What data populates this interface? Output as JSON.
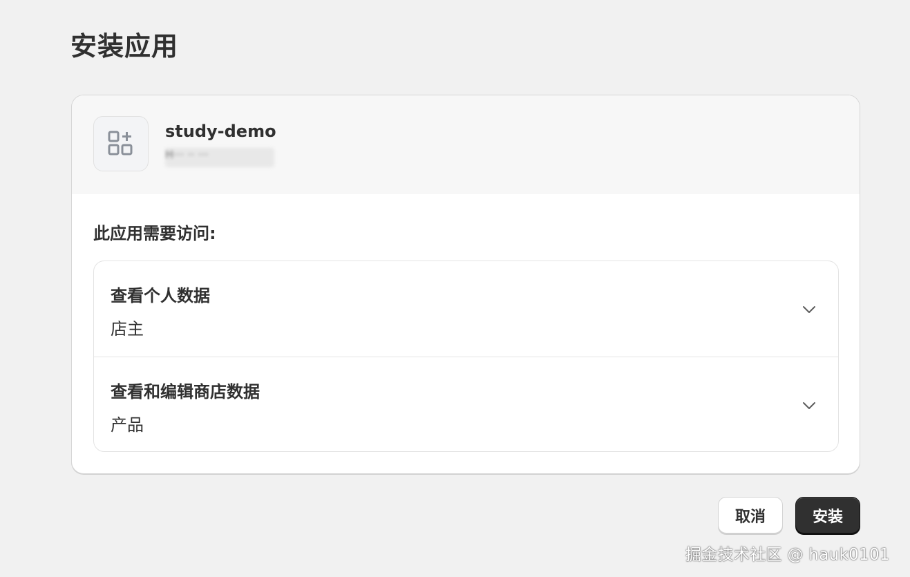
{
  "page": {
    "title": "安装应用"
  },
  "app": {
    "name": "study-demo",
    "subtitle_redacted": "H··· ·· ···",
    "icon": "apps-plus-icon"
  },
  "access": {
    "label": "此应用需要访问:",
    "permissions": [
      {
        "title": "查看个人数据",
        "detail": "店主",
        "icon": "chevron-down-icon"
      },
      {
        "title": "查看和编辑商店数据",
        "detail": "产品",
        "icon": "chevron-down-icon"
      }
    ]
  },
  "actions": {
    "cancel_label": "取消",
    "install_label": "安装"
  },
  "watermark": {
    "text": "掘金技术社区 @ hauk0101"
  },
  "colors": {
    "background": "#f1f1f1",
    "card": "#ffffff",
    "header": "#f7f7f7",
    "primary_button": "#303030",
    "text": "#303030"
  }
}
